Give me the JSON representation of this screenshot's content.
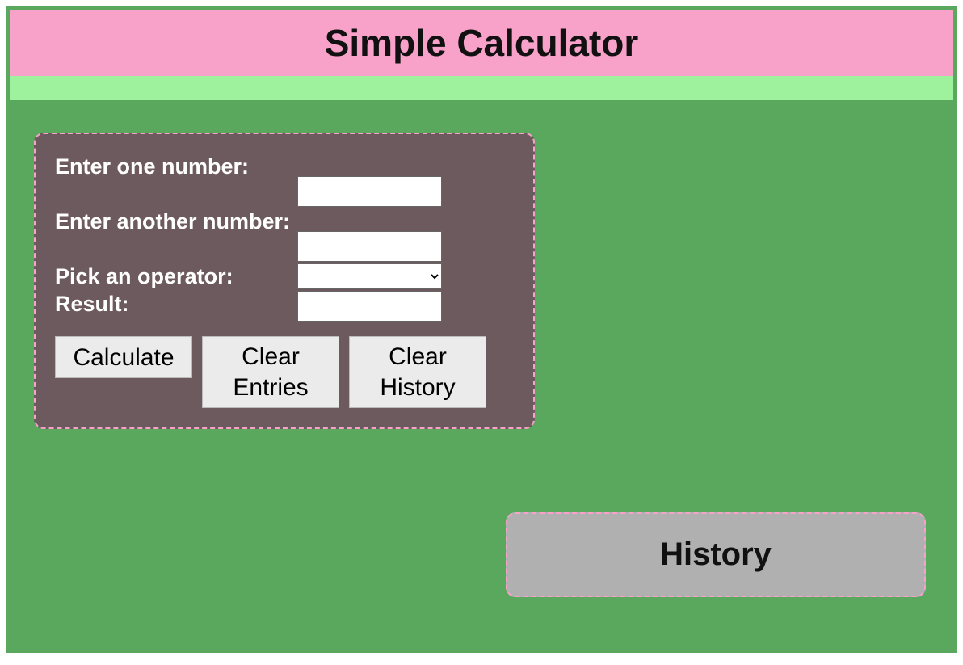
{
  "header": {
    "title": "Simple Calculator"
  },
  "form": {
    "label_one": "Enter one number:",
    "label_two": "Enter another number:",
    "label_operator": "Pick an operator:",
    "label_result": "Result:",
    "value_one": "",
    "value_two": "",
    "value_result": "",
    "operator_selected": ""
  },
  "buttons": {
    "calculate": "Calculate",
    "clear_entries": "Clear Entries",
    "clear_history": "Clear History"
  },
  "history": {
    "title": "History"
  }
}
